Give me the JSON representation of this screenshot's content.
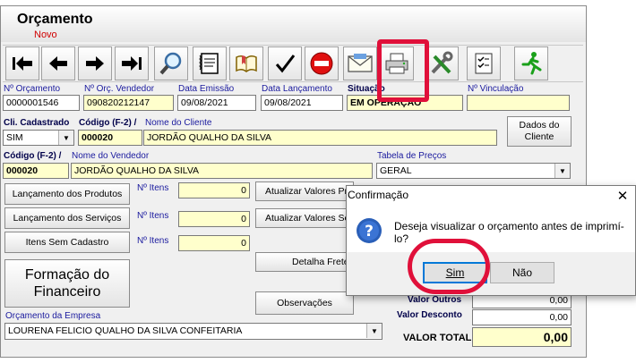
{
  "window": {
    "title": "Orçamento",
    "subtitle": "Novo"
  },
  "toolbar": {
    "buttons": [
      {
        "name": "first-record-button",
        "icon": "first-record-icon"
      },
      {
        "name": "previous-record-button",
        "icon": "previous-record-icon"
      },
      {
        "name": "next-record-button",
        "icon": "next-record-icon"
      },
      {
        "name": "last-record-button",
        "icon": "last-record-icon"
      },
      {
        "name": "search-button",
        "icon": "magnifier-icon"
      },
      {
        "name": "notes-button",
        "icon": "notes-icon"
      },
      {
        "name": "book-button",
        "icon": "book-icon"
      },
      {
        "name": "confirm-button",
        "icon": "checkmark-icon"
      },
      {
        "name": "cancel-button",
        "icon": "no-entry-icon"
      },
      {
        "name": "email-button",
        "icon": "envelope-icon"
      },
      {
        "name": "print-button",
        "icon": "printer-icon"
      },
      {
        "name": "tools-button",
        "icon": "tools-icon"
      },
      {
        "name": "checklist-button",
        "icon": "checklist-icon"
      },
      {
        "name": "exit-button",
        "icon": "running-man-icon"
      }
    ]
  },
  "header_fields": {
    "num_orcamento": {
      "label": "Nº Orçamento",
      "value": "0000001546"
    },
    "num_orc_vendedor": {
      "label": "Nº Orç. Vendedor",
      "value": "090820212147"
    },
    "data_emissao": {
      "label": "Data Emissão",
      "value": "09/08/2021"
    },
    "data_lancamento": {
      "label": "Data Lançamento",
      "value": "09/08/2021"
    },
    "situacao": {
      "label": "Situação",
      "value": "EM OPERAÇÃO"
    },
    "num_vinculacao": {
      "label": "Nº Vinculação",
      "value": ""
    }
  },
  "cliente": {
    "cli_cadastrado": {
      "label": "Cli. Cadastrado",
      "value": "SIM"
    },
    "codigo": {
      "label": "Código (F-2) /",
      "value": "000020"
    },
    "nome": {
      "label": "Nome do Cliente",
      "value": "JORDÃO QUALHO DA SILVA"
    },
    "dados_button": {
      "line1": "Dados do",
      "line2": "Cliente"
    }
  },
  "vendedor": {
    "codigo": {
      "label": "Código (F-2) /",
      "value": "000020"
    },
    "nome": {
      "label": "Nome do Vendedor",
      "value": "JORDÃO QUALHO DA SILVA"
    }
  },
  "tabela_precos": {
    "label": "Tabela de Preços",
    "value": "GERAL"
  },
  "itens": {
    "lanc_produtos": "Lançamento dos Produtos",
    "lanc_servicos": "Lançamento dos Serviços",
    "itens_sem_cadastro": "Itens Sem Cadastro",
    "n_itens_label": "Nº Itens",
    "n_itens_1": "0",
    "n_itens_2": "0",
    "n_itens_3": "0",
    "atualizar_pr": "Atualizar Valores Pr",
    "atualizar_se": "Atualizar Valores Se",
    "detalha_frete": "Detalha Frete",
    "observacoes": "Observações",
    "formacao_line1": "Formação do",
    "formacao_line2": "Financeiro"
  },
  "empresa": {
    "label": "Orçamento da Empresa",
    "value": "LOURENA FELICIO QUALHO DA SILVA CONFEITARIA"
  },
  "totais": {
    "valor_outros_label": "Valor Outros",
    "valor_outros": "0,00",
    "valor_desconto_label": "Valor Desconto",
    "valor_desconto": "0,00",
    "valor_total_label": "VALOR TOTAL",
    "valor_total": "0,00"
  },
  "dialog": {
    "title": "Confirmação",
    "close": "✕",
    "message": "Deseja visualizar o orçamento antes de imprimí-lo?",
    "yes": "Sim",
    "no": "Não"
  },
  "colors": {
    "highlight": "#e0103a",
    "field": "#ffffcc",
    "label": "#1a1a9e"
  }
}
